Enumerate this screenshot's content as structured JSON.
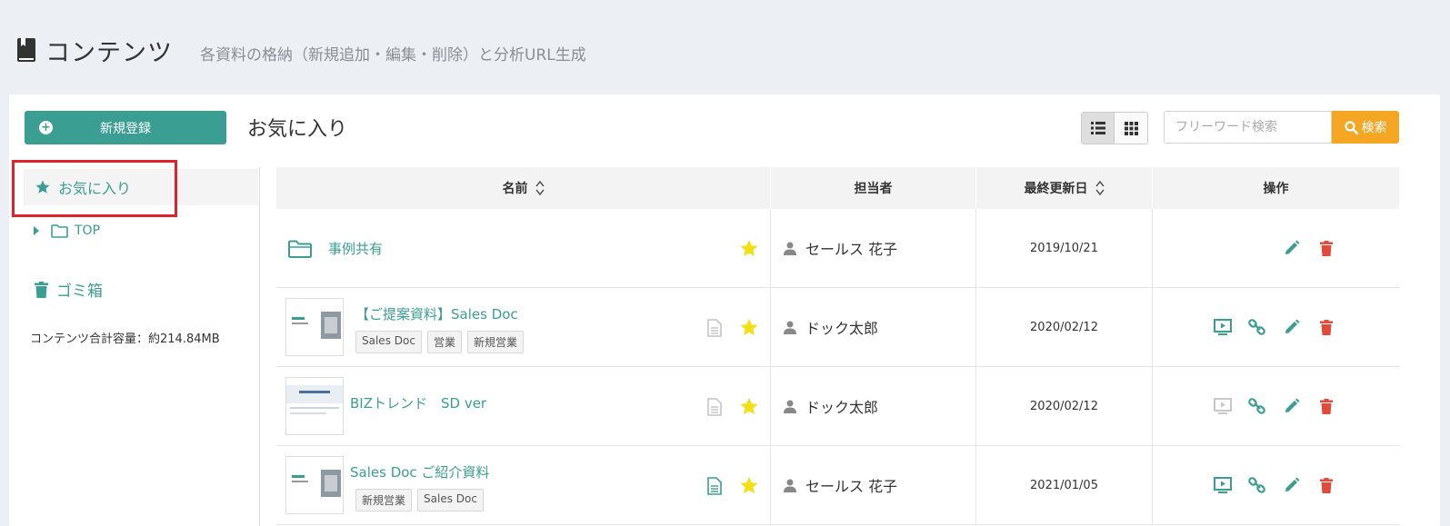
{
  "header": {
    "title": "コンテンツ",
    "description": "各資料の格納（新規追加・編集・削除）と分析URL生成"
  },
  "toolbar": {
    "new_button": "新規登録",
    "section_title": "お気に入り",
    "search_placeholder": "フリーワード検索",
    "search_button": "検索"
  },
  "sidebar": {
    "favorites": "お気に入り",
    "top_folder": "TOP",
    "trash": "ゴミ箱",
    "capacity": "コンテンツ合計容量：約214.84MB"
  },
  "table": {
    "headers": {
      "name": "名前",
      "owner": "担当者",
      "date": "最終更新日",
      "ops": "操作"
    },
    "rows": [
      {
        "type": "folder",
        "name": "事例共有",
        "tags": [],
        "owner": "セールス 花子",
        "date": "2019/10/21"
      },
      {
        "type": "file",
        "name": "【ご提案資料】Sales Doc",
        "tags": [
          "Sales Doc",
          "営業",
          "新規営業"
        ],
        "owner": "ドック太郎",
        "date": "2020/02/12"
      },
      {
        "type": "file",
        "name": "BIZトレンド　SD ver",
        "tags": [],
        "owner": "ドック太郎",
        "date": "2020/02/12"
      },
      {
        "type": "file",
        "name": "Sales Doc ご紹介資料",
        "tags": [
          "新規営業",
          "Sales Doc"
        ],
        "owner": "セールス 花子",
        "date": "2021/01/05"
      }
    ]
  },
  "colors": {
    "accent": "#3a9e93",
    "search": "#f5a623",
    "star": "#f2e014",
    "delete": "#e04b3c",
    "highlight": "#e2222a"
  }
}
